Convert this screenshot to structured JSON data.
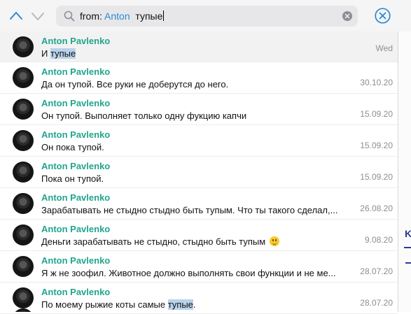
{
  "search": {
    "prefix": "from:",
    "name": "Anton",
    "query": "тупые"
  },
  "results": [
    {
      "sender": "Anton Pavlenko",
      "before": "И ",
      "highlight": "тупые",
      "after": "",
      "date": "Wed"
    },
    {
      "sender": "Anton Pavlenko",
      "before": "Да он тупой. Все руки не доберутся до него.",
      "highlight": "",
      "after": "",
      "date": "30.10.20"
    },
    {
      "sender": "Anton Pavlenko",
      "before": "Он тупой. Выполняет только одну фукцию капчи",
      "highlight": "",
      "after": "",
      "date": "15.09.20"
    },
    {
      "sender": "Anton Pavlenko",
      "before": "Он пока тупой.",
      "highlight": "",
      "after": "",
      "date": "15.09.20"
    },
    {
      "sender": "Anton Pavlenko",
      "before": "Пока он тупой.",
      "highlight": "",
      "after": "",
      "date": "15.09.20"
    },
    {
      "sender": "Anton Pavlenko",
      "before": "Зарабатывать не стыдно стыдно быть тупым. Что ты такого сделал,...",
      "highlight": "",
      "after": "",
      "date": "26.08.20"
    },
    {
      "sender": "Anton Pavlenko",
      "before": "Деньги зарабатывать не стыдно, стыдно быть тупым",
      "highlight": "",
      "after": "",
      "date": "9.08.20",
      "emoji": "slightly-smiling-face"
    },
    {
      "sender": "Anton Pavlenko",
      "before": "Я ж не зоофил. Животное должно выполнять свои функции и не ме...",
      "highlight": "",
      "after": "",
      "date": "28.07.20"
    },
    {
      "sender": "Anton Pavlenko",
      "before": "По моему рыжие коты самые ",
      "highlight": "тупые",
      "after": ".",
      "date": "28.07.20"
    }
  ],
  "right_peek": {
    "letter": "K"
  },
  "colors": {
    "sender": "#21a58d",
    "accent": "#2a8ad5",
    "highlight": "#b9d2ea"
  }
}
